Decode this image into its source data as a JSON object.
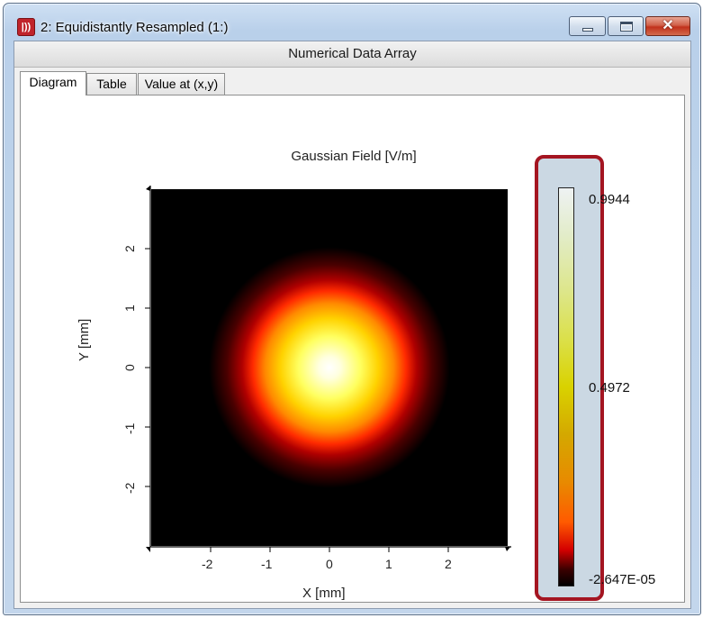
{
  "window": {
    "title": "2: Equidistantly Resampled (1:)",
    "icon": "application-icon",
    "icon_glyph": "|))",
    "buttons": {
      "minimize": "minimize-icon",
      "maximize": "maximize-icon",
      "close": "close-icon",
      "close_glyph": "✕"
    }
  },
  "header": {
    "title": "Numerical Data Array"
  },
  "tabs": [
    {
      "label": "Diagram",
      "active": true
    },
    {
      "label": "Table",
      "active": false
    },
    {
      "label": "Value at (x,y)",
      "active": false
    }
  ],
  "chart_data": {
    "type": "heatmap",
    "title": "Gaussian Field   [V/m]",
    "xlabel": "X [mm]",
    "ylabel": "Y [mm]",
    "xlim": [
      -3,
      3
    ],
    "ylim": [
      -3,
      3
    ],
    "x_ticks": [
      -2,
      -1,
      0,
      1,
      2
    ],
    "y_ticks": [
      -2,
      -1,
      0,
      1,
      2
    ],
    "colorbar": {
      "max_label": "0.9944",
      "mid_label": "0.4972",
      "min_label": "-2.647E-05",
      "min": -2.647e-05,
      "max": 0.9944,
      "colormap": "black-red-yellow-white",
      "highlight_color": "#a41521"
    },
    "field": {
      "center": [
        0,
        0
      ],
      "peak": 0.9944,
      "waist_mm": 1.5
    }
  }
}
